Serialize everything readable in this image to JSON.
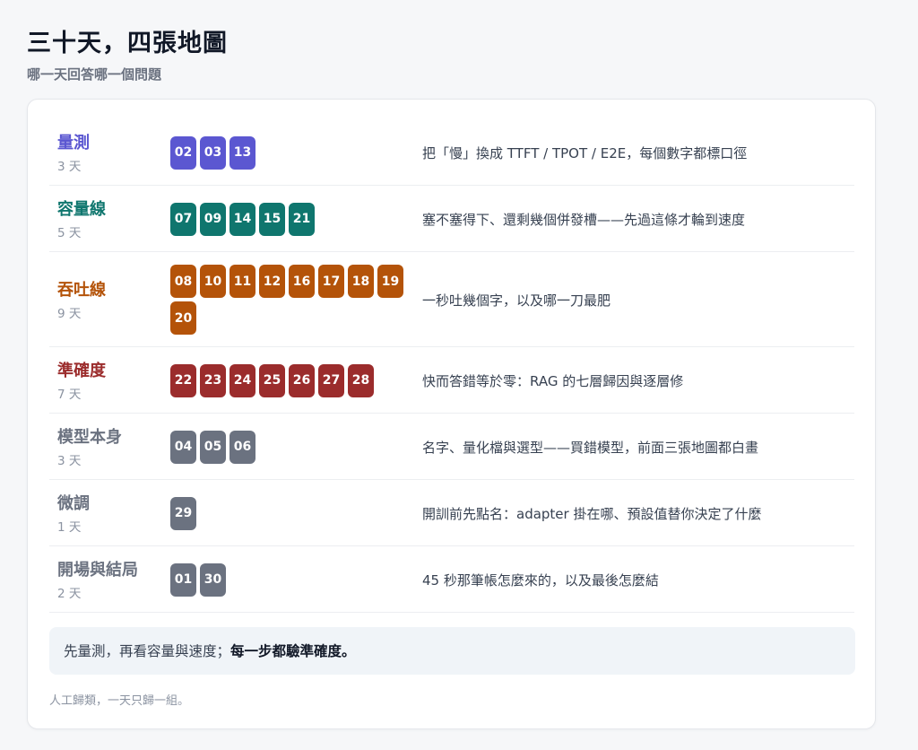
{
  "header": {
    "title": "三十天，四張地圖",
    "subtitle": "哪一天回答哪一個問題"
  },
  "rows": [
    {
      "name": "量測",
      "days": "3 天",
      "color": "#5b57d1",
      "chips": [
        "02",
        "03",
        "13"
      ],
      "desc": "把「慢」換成 TTFT / TPOT / E2E，每個數字都標口徑"
    },
    {
      "name": "容量線",
      "days": "5 天",
      "color": "#0f766e",
      "chips": [
        "07",
        "09",
        "14",
        "15",
        "21"
      ],
      "desc": "塞不塞得下、還剩幾個併發槽——先過這條才輪到速度"
    },
    {
      "name": "吞吐線",
      "days": "9 天",
      "color": "#b45309",
      "chips": [
        "08",
        "10",
        "11",
        "12",
        "16",
        "17",
        "18",
        "19",
        "20"
      ],
      "desc": "一秒吐幾個字，以及哪一刀最肥"
    },
    {
      "name": "準確度",
      "days": "7 天",
      "color": "#9b2c2c",
      "chips": [
        "22",
        "23",
        "24",
        "25",
        "26",
        "27",
        "28"
      ],
      "desc": "快而答錯等於零：RAG 的七層歸因與逐層修"
    },
    {
      "name": "模型本身",
      "days": "3 天",
      "color": "#6b7280",
      "chips": [
        "04",
        "05",
        "06"
      ],
      "desc": "名字、量化檔與選型——買錯模型，前面三張地圖都白畫"
    },
    {
      "name": "微調",
      "days": "1 天",
      "color": "#6b7280",
      "chips": [
        "29"
      ],
      "desc": "開訓前先點名：adapter 掛在哪、預設值替你決定了什麼"
    },
    {
      "name": "開場與結局",
      "days": "2 天",
      "color": "#6b7280",
      "chips": [
        "01",
        "30"
      ],
      "desc": "45 秒那筆帳怎麼來的，以及最後怎麼結"
    }
  ],
  "summary": {
    "lead": "先量測，再看容量與速度；",
    "emphasis": "每一步都驗準確度。"
  },
  "footnote": "人工歸類，一天只歸一組。"
}
